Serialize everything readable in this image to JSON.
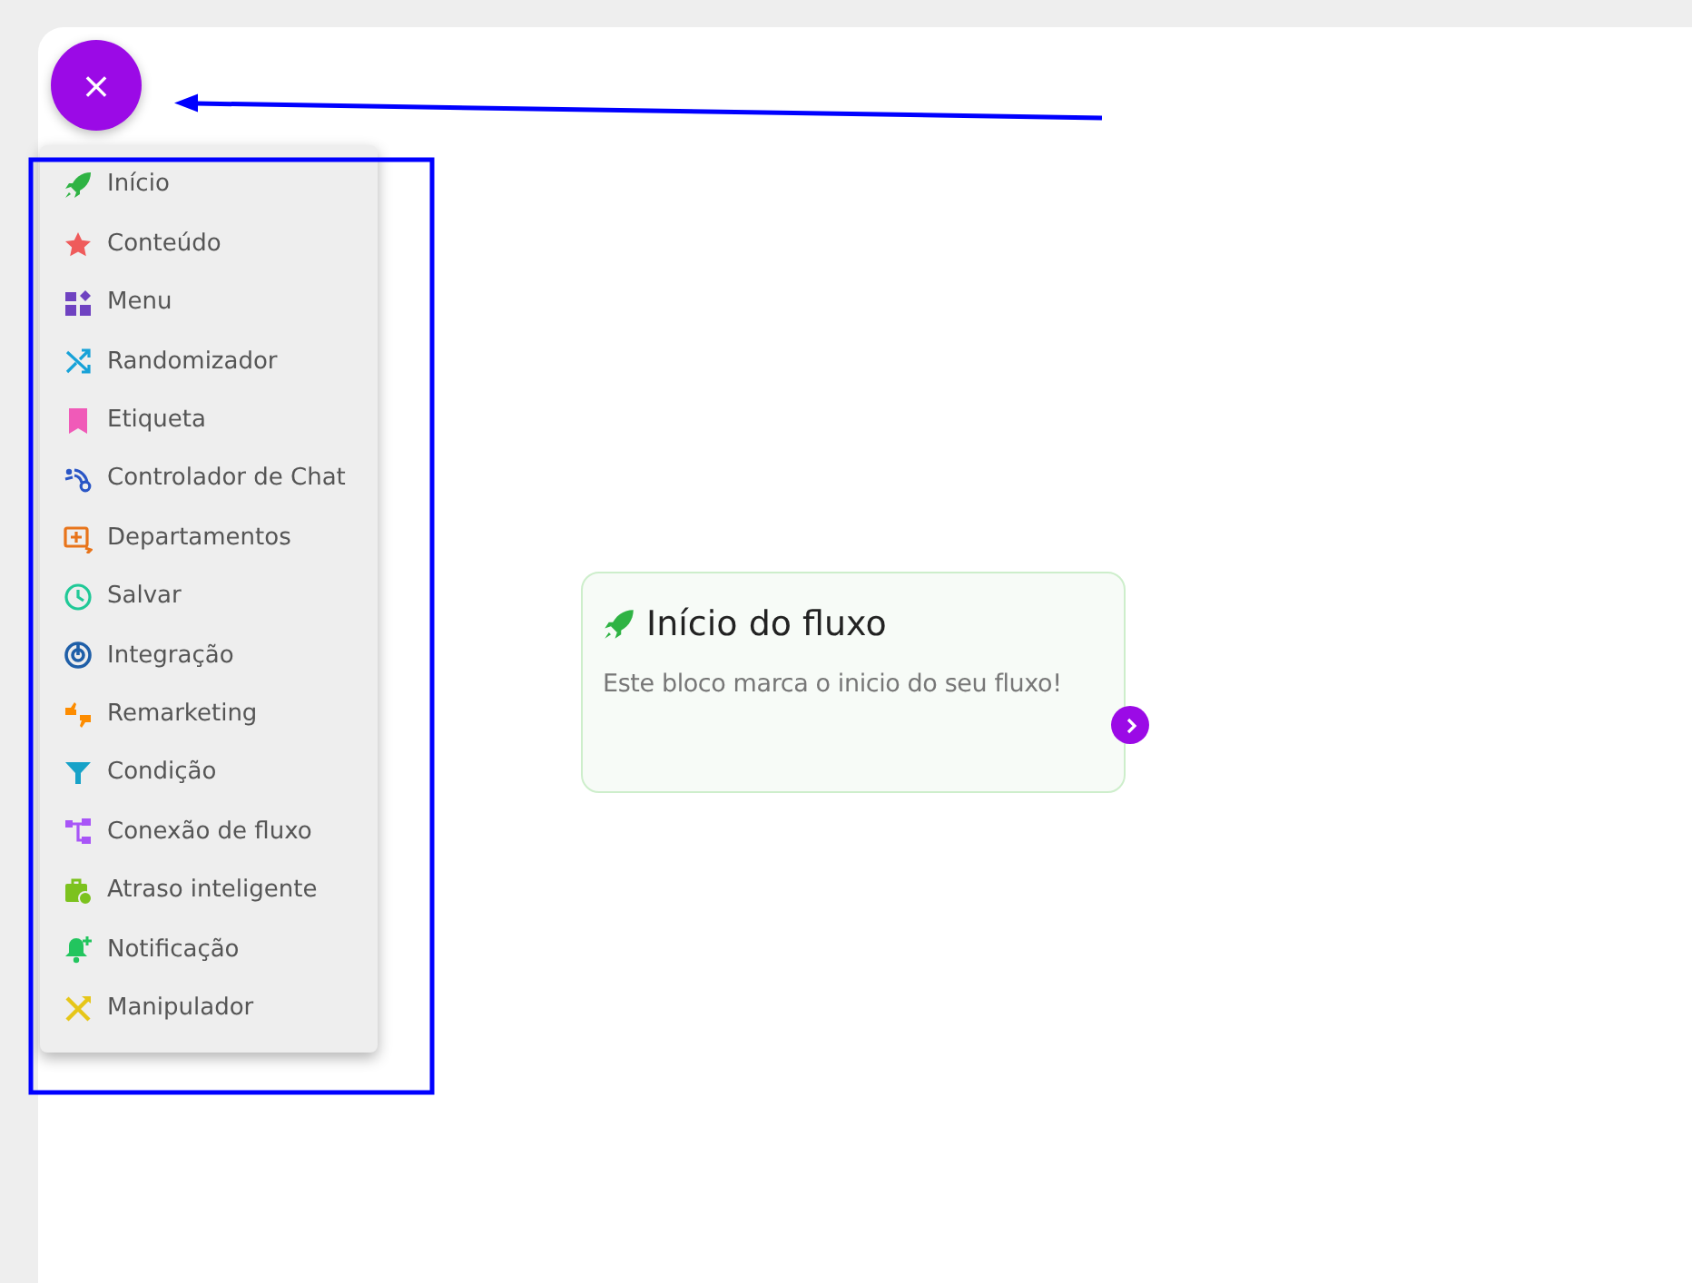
{
  "close_button": {
    "label": "×"
  },
  "menu": {
    "items": [
      {
        "label": "Início",
        "color": "#2fb344"
      },
      {
        "label": "Conteúdo",
        "color": "#ef5b5b"
      },
      {
        "label": "Menu",
        "color": "#6f42c1"
      },
      {
        "label": "Randomizador",
        "color": "#17a2d8"
      },
      {
        "label": "Etiqueta",
        "color": "#f05ab8"
      },
      {
        "label": "Controlador de Chat",
        "color": "#2a56c6"
      },
      {
        "label": "Departamentos",
        "color": "#e8741a"
      },
      {
        "label": "Salvar",
        "color": "#20c997"
      },
      {
        "label": "Integração",
        "color": "#1f5fa8"
      },
      {
        "label": "Remarketing",
        "color": "#fd8c00"
      },
      {
        "label": "Condição",
        "color": "#17a2c8"
      },
      {
        "label": "Conexão de fluxo",
        "color": "#a855f7"
      },
      {
        "label": "Atraso inteligente",
        "color": "#7cc21e"
      },
      {
        "label": "Notificação",
        "color": "#22c55e"
      },
      {
        "label": "Manipulador",
        "color": "#e6c619"
      }
    ]
  },
  "node": {
    "title": "Início do fluxo",
    "description": "Este bloco marca o inicio do seu fluxo!"
  }
}
